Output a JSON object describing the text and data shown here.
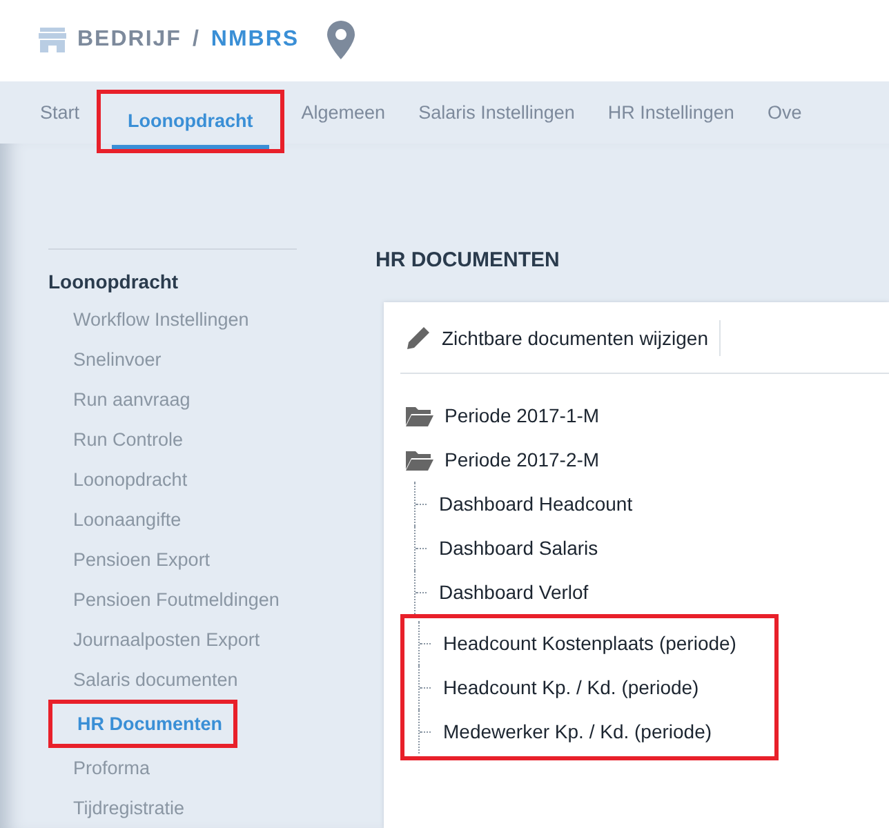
{
  "header": {
    "company": "BEDRIJF",
    "separator": "/",
    "name": "NMBRS"
  },
  "tabs": [
    {
      "label": "Start",
      "selected": false,
      "highlighted": false
    },
    {
      "label": "Loonopdracht",
      "selected": true,
      "highlighted": true
    },
    {
      "label": "Algemeen",
      "selected": false,
      "highlighted": false
    },
    {
      "label": "Salaris Instellingen",
      "selected": false,
      "highlighted": false
    },
    {
      "label": "HR Instellingen",
      "selected": false,
      "highlighted": false
    },
    {
      "label": "Ove",
      "selected": false,
      "highlighted": false
    }
  ],
  "sidebar": {
    "heading": "Loonopdracht",
    "items": [
      {
        "label": "Workflow Instellingen",
        "selected": false,
        "highlighted": false
      },
      {
        "label": "Snelinvoer",
        "selected": false,
        "highlighted": false
      },
      {
        "label": "Run aanvraag",
        "selected": false,
        "highlighted": false
      },
      {
        "label": "Run Controle",
        "selected": false,
        "highlighted": false
      },
      {
        "label": "Loonopdracht",
        "selected": false,
        "highlighted": false
      },
      {
        "label": "Loonaangifte",
        "selected": false,
        "highlighted": false
      },
      {
        "label": "Pensioen Export",
        "selected": false,
        "highlighted": false
      },
      {
        "label": "Pensioen Foutmeldingen",
        "selected": false,
        "highlighted": false
      },
      {
        "label": "Journaalposten Export",
        "selected": false,
        "highlighted": false
      },
      {
        "label": "Salaris documenten",
        "selected": false,
        "highlighted": false
      },
      {
        "label": "HR Documenten",
        "selected": true,
        "highlighted": true
      },
      {
        "label": "Proforma",
        "selected": false,
        "highlighted": false
      },
      {
        "label": "Tijdregistratie",
        "selected": false,
        "highlighted": false
      }
    ]
  },
  "main": {
    "title": "HR DOCUMENTEN",
    "toolbar_button": "Zichtbare documenten wijzigen",
    "tree": [
      {
        "label": "Periode 2017-1-M"
      },
      {
        "label": "Periode 2017-2-M",
        "children": [
          {
            "label": "Dashboard Headcount",
            "highlighted": false
          },
          {
            "label": "Dashboard Salaris",
            "highlighted": false
          },
          {
            "label": "Dashboard Verlof",
            "highlighted": false
          },
          {
            "label": "Headcount Kostenplaats (periode)",
            "highlighted": true
          },
          {
            "label": "Headcount Kp. / Kd. (periode)",
            "highlighted": true
          },
          {
            "label": "Medewerker Kp. / Kd. (periode)",
            "highlighted": true
          }
        ]
      }
    ]
  }
}
